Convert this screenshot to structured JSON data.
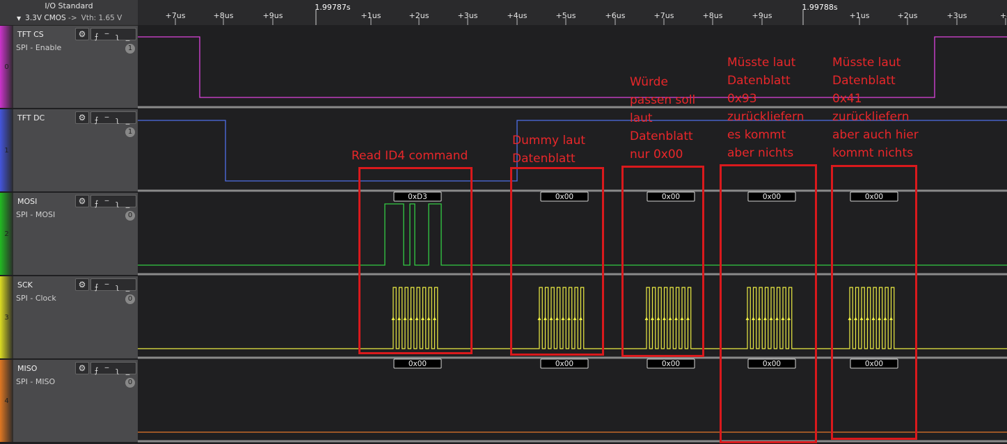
{
  "io": {
    "title": "I/O Standard",
    "standard": "3.3V CMOS",
    "arrow": "->",
    "vth": "Vth: 1.65 V"
  },
  "timeline": {
    "major": [
      {
        "label": "1.99787s"
      },
      {
        "label": "1.99788s"
      }
    ],
    "ticks": [
      "+7us",
      "+8us",
      "+9us",
      "+1us",
      "+2us",
      "+3us",
      "+4us",
      "+5us",
      "+6us",
      "+7us",
      "+8us",
      "+9us",
      "+1us",
      "+2us",
      "+3us",
      "+4"
    ]
  },
  "channels": [
    {
      "index": "0",
      "name": "TFT CS",
      "protocol": "SPI - Enable",
      "badge": "1",
      "strip_color": "#cc33cc",
      "wave_color": "#dd44dd"
    },
    {
      "index": "1",
      "name": "TFT DC",
      "protocol": "",
      "badge": "1",
      "strip_color": "#4455dd",
      "wave_color": "#4f6fe8"
    },
    {
      "index": "2",
      "name": "MOSI",
      "protocol": "SPI - MOSI",
      "badge": "0",
      "strip_color": "#22bb22",
      "wave_color": "#33cc44"
    },
    {
      "index": "3",
      "name": "SCK",
      "protocol": "SPI - Clock",
      "badge": "0",
      "strip_color": "#dddd22",
      "wave_color": "#eeee44"
    },
    {
      "index": "4",
      "name": "MISO",
      "protocol": "SPI - MISO",
      "badge": "0",
      "strip_color": "#e07722",
      "wave_color": "#e8772a"
    }
  ],
  "icons": {
    "gear": "gear-icon",
    "rising": "rising-edge-icon",
    "high": "high-level-icon",
    "falling": "falling-edge-icon",
    "low": "low-level-icon"
  },
  "decoded": {
    "mosi": [
      "0xD3",
      "0x00",
      "0x00",
      "0x00",
      "0x00"
    ],
    "miso": [
      "0x00",
      "0x00",
      "0x00",
      "0x00",
      "0x00"
    ]
  },
  "annotations": [
    {
      "text": "Read ID4 command"
    },
    {
      "text": "Dummy laut\nDatenblatt"
    },
    {
      "text": "Würde\npassen soll\nlaut\nDatenblatt\nnur 0x00"
    },
    {
      "text": "Müsste laut\nDatenblatt\n0x93\nzurückliefern\nes kommt\naber nichts"
    },
    {
      "text": "Müsste laut\nDatenblatt\n0x41\nzurückliefern\naber auch hier\nkommt nichts"
    }
  ],
  "colors": {
    "annotation_red": "#d9191c",
    "background": "#1f1f21",
    "separator": "#9a9a9a"
  }
}
